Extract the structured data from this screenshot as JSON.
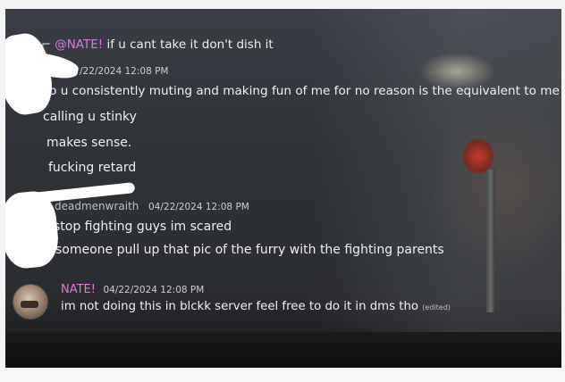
{
  "messages": [
    {
      "reply_preview": {
        "mention": "@NATE!",
        "text": "if u cant take it don't dish it"
      },
      "timestamp": "/22/2024 12:08 PM",
      "lines": [
        "so u consistently muting and making fun of me for no reason is the equivalent to me",
        "calling u stinky",
        "makes sense.",
        "fucking retard"
      ]
    },
    {
      "author_partial": "deadmenwraith",
      "timestamp": "04/22/2024 12:08 PM",
      "lines": [
        "stop fighting guys im scared",
        "someone pull up that pic of the furry with the fighting parents"
      ]
    },
    {
      "author": "NATE!",
      "timestamp": "04/22/2024 12:08 PM",
      "text": "im not doing this in blckk server feel free to do it in dms tho",
      "edited": "(edited)"
    }
  ],
  "colors": {
    "mention": "#d47be0",
    "username": "#e07ad8"
  }
}
